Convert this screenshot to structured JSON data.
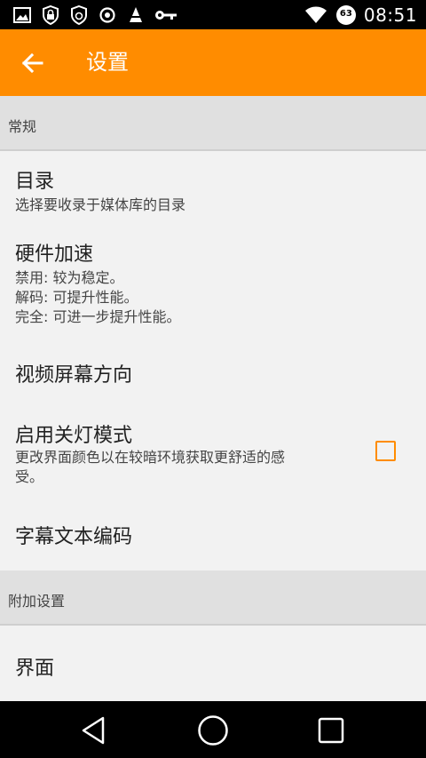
{
  "statusbar": {
    "time": "08:51",
    "battery_level": "63",
    "icons_left": [
      "image-icon",
      "shield-lock-icon",
      "shield-refresh-icon",
      "sync-icon",
      "vlc-cone-icon",
      "key-icon"
    ],
    "icons_right": [
      "wifi-icon",
      "battery-icon"
    ]
  },
  "appbar": {
    "title": "设置",
    "back_icon": "back-arrow-icon",
    "color": "#ff8c00"
  },
  "sections": [
    {
      "header": "常规",
      "items": [
        {
          "title": "目录",
          "summary": "选择要收录于媒体库的目录"
        },
        {
          "title": "硬件加速",
          "summary_lines": [
            "禁用: 较为稳定。",
            "解码: 可提升性能。",
            "完全: 可进一步提升性能。"
          ]
        },
        {
          "title": "视频屏幕方向"
        },
        {
          "title": "启用关灯模式",
          "summary_lines": [
            "更改界面颜色以在较暗环境获取更舒适的感",
            "受。"
          ],
          "checked": false
        },
        {
          "title": "字幕文本编码"
        }
      ]
    },
    {
      "header": "附加设置",
      "items": [
        {
          "title": "界面"
        }
      ]
    }
  ],
  "navbar": {
    "buttons": [
      "back-triangle-icon",
      "home-circle-icon",
      "recents-square-icon"
    ]
  }
}
